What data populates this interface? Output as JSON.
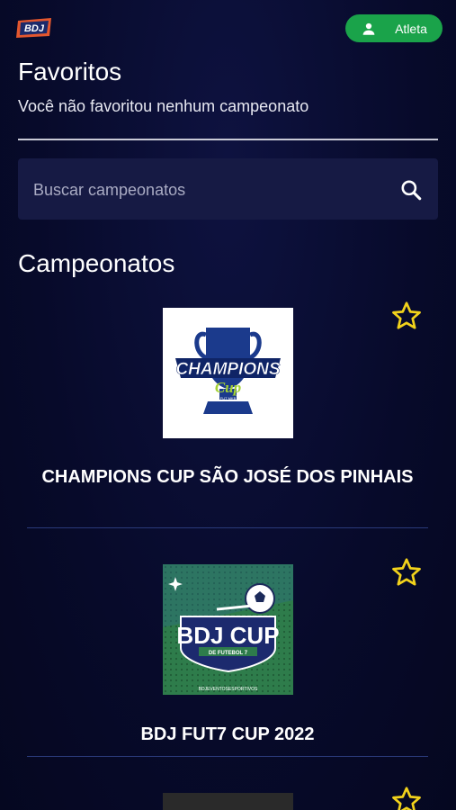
{
  "header": {
    "logo_text": "BDJ",
    "role_button_label": "Atleta"
  },
  "favorites": {
    "title": "Favoritos",
    "empty_message": "Você não favoritou nenhum campeonato"
  },
  "search": {
    "placeholder": "Buscar campeonatos",
    "value": ""
  },
  "championships": {
    "title": "Campeonatos",
    "items": [
      {
        "name": "CHAMPIONS CUP SÃO JOSÉ DOS PINHAIS",
        "logo_text": "CHAMPIONS",
        "logo_subtext": "Cup",
        "logo_tagline": "FUT MKB",
        "favorited": false
      },
      {
        "name": "BDJ FUT7 CUP 2022",
        "logo_text": "BDJ CUP",
        "logo_subtext": "DE FUTEBOL 7",
        "logo_footer": "BDJEVENTOSESPORTIVOS",
        "favorited": false
      },
      {
        "name": "",
        "favorited": false
      }
    ]
  },
  "colors": {
    "background": "#080a2c",
    "accent_green": "#1aa34a",
    "star_yellow": "#f2d21b",
    "search_bg": "#161a44"
  }
}
